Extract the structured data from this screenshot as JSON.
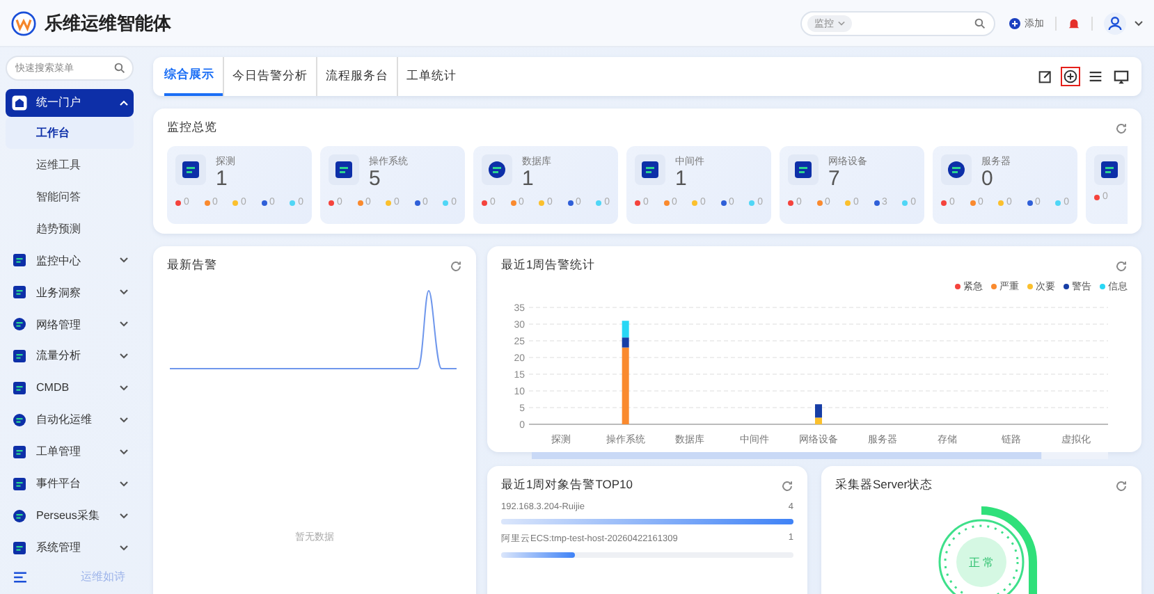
{
  "header": {
    "title": "乐维运维智能体",
    "search_scope": "监控",
    "add_label": "添加"
  },
  "sidebar": {
    "search": {
      "placeholder": "快速搜索菜单"
    },
    "items": [
      {
        "label": "统一门户",
        "expanded": true,
        "selected": true,
        "children": [
          {
            "label": "工作台",
            "selected": true
          },
          {
            "label": "运维工具",
            "selected": false
          },
          {
            "label": "智能问答",
            "selected": false
          },
          {
            "label": "趋势预测",
            "selected": false
          }
        ]
      },
      {
        "label": "监控中心",
        "expanded": false,
        "selected": false
      },
      {
        "label": "业务洞察",
        "expanded": false,
        "selected": false
      },
      {
        "label": "网络管理",
        "expanded": false,
        "selected": false
      },
      {
        "label": "流量分析",
        "expanded": false,
        "selected": false
      },
      {
        "label": "CMDB",
        "expanded": false,
        "selected": false
      },
      {
        "label": "自动化运维",
        "expanded": false,
        "selected": false
      },
      {
        "label": "工单管理",
        "expanded": false,
        "selected": false
      },
      {
        "label": "事件平台",
        "expanded": false,
        "selected": false
      },
      {
        "label": "Perseus采集",
        "expanded": false,
        "selected": false
      },
      {
        "label": "系统管理",
        "expanded": false,
        "selected": false
      }
    ],
    "footer": "运维如诗"
  },
  "tabs": [
    {
      "label": "综合展示",
      "selected": true
    },
    {
      "label": "今日告警分析",
      "selected": false
    },
    {
      "label": "流程服务台",
      "selected": false
    },
    {
      "label": "工单统计",
      "selected": false
    }
  ],
  "toolbar": [
    {
      "kind": "edit",
      "highlighted": false
    },
    {
      "kind": "add",
      "highlighted": true
    },
    {
      "kind": "list",
      "highlighted": false
    },
    {
      "kind": "screen",
      "highlighted": false
    }
  ],
  "overview": {
    "title": "监控总览",
    "cards": [
      {
        "name": "探测",
        "count": "1",
        "stats": [
          {
            "color": "#f5433d",
            "value": "0"
          },
          {
            "color": "#fa8a2e",
            "value": "0"
          },
          {
            "color": "#fbc02d",
            "value": "0"
          },
          {
            "color": "#2f5fd8",
            "value": "0"
          },
          {
            "color": "#4fd6f6",
            "value": "0"
          }
        ]
      },
      {
        "name": "操作系统",
        "count": "5",
        "stats": [
          {
            "color": "#f5433d",
            "value": "0"
          },
          {
            "color": "#fa8a2e",
            "value": "0"
          },
          {
            "color": "#fbc02d",
            "value": "0"
          },
          {
            "color": "#2f5fd8",
            "value": "0"
          },
          {
            "color": "#4fd6f6",
            "value": "0"
          }
        ]
      },
      {
        "name": "数据库",
        "count": "1",
        "stats": [
          {
            "color": "#f5433d",
            "value": "0"
          },
          {
            "color": "#fa8a2e",
            "value": "0"
          },
          {
            "color": "#fbc02d",
            "value": "0"
          },
          {
            "color": "#2f5fd8",
            "value": "0"
          },
          {
            "color": "#4fd6f6",
            "value": "0"
          }
        ]
      },
      {
        "name": "中间件",
        "count": "1",
        "stats": [
          {
            "color": "#f5433d",
            "value": "0"
          },
          {
            "color": "#fa8a2e",
            "value": "0"
          },
          {
            "color": "#fbc02d",
            "value": "0"
          },
          {
            "color": "#2f5fd8",
            "value": "0"
          },
          {
            "color": "#4fd6f6",
            "value": "0"
          }
        ]
      },
      {
        "name": "网络设备",
        "count": "7",
        "stats": [
          {
            "color": "#f5433d",
            "value": "0"
          },
          {
            "color": "#fa8a2e",
            "value": "0"
          },
          {
            "color": "#fbc02d",
            "value": "0"
          },
          {
            "color": "#2f5fd8",
            "value": "3"
          },
          {
            "color": "#4fd6f6",
            "value": "0"
          }
        ]
      },
      {
        "name": "服务器",
        "count": "0",
        "stats": [
          {
            "color": "#f5433d",
            "value": "0"
          },
          {
            "color": "#fa8a2e",
            "value": "0"
          },
          {
            "color": "#fbc02d",
            "value": "0"
          },
          {
            "color": "#2f5fd8",
            "value": "0"
          },
          {
            "color": "#4fd6f6",
            "value": "0"
          }
        ]
      },
      {
        "stats": [
          {
            "color": "#f5433d",
            "value": "0"
          }
        ]
      }
    ]
  },
  "latest_alerts": {
    "title": "最新告警",
    "empty_text": "暂无数据"
  },
  "weekly_stats": {
    "title": "最近1周告警统计",
    "chart_data": {
      "type": "bar",
      "stacked": true,
      "grid": true,
      "categories": [
        "探测",
        "操作系统",
        "数据库",
        "中间件",
        "网络设备",
        "服务器",
        "存储",
        "链路",
        "虚拟化"
      ],
      "ylim": [
        0,
        35
      ],
      "yticks": [
        0,
        5,
        10,
        15,
        20,
        25,
        30,
        35
      ],
      "series": [
        {
          "name": "紧急",
          "color": "#f5433d",
          "values": [
            0,
            0,
            0,
            0,
            0,
            0,
            0,
            0,
            0
          ]
        },
        {
          "name": "严重",
          "color": "#fa8a2e",
          "values": [
            0,
            23,
            0,
            0,
            0,
            0,
            0,
            0,
            0
          ]
        },
        {
          "name": "次要",
          "color": "#fbc02d",
          "values": [
            0,
            0,
            0,
            0,
            2,
            0,
            0,
            0,
            0
          ]
        },
        {
          "name": "警告",
          "color": "#173ea6",
          "values": [
            0,
            3,
            0,
            0,
            4,
            0,
            0,
            0,
            0
          ]
        },
        {
          "name": "信息",
          "color": "#29d7f5",
          "values": [
            0,
            5,
            0,
            0,
            0,
            0,
            0,
            0,
            0
          ]
        }
      ]
    }
  },
  "top10": {
    "title": "最近1周对象告警TOP10",
    "rows": [
      {
        "label": "192.168.3.204-Ruijie",
        "value": "4",
        "level": 1
      },
      {
        "label": "阿里云ECS:tmp-test-host-20260422161309",
        "value": "1",
        "level": 0.25
      }
    ]
  },
  "collector": {
    "title": "采集器Server状态",
    "status": "正 常"
  }
}
